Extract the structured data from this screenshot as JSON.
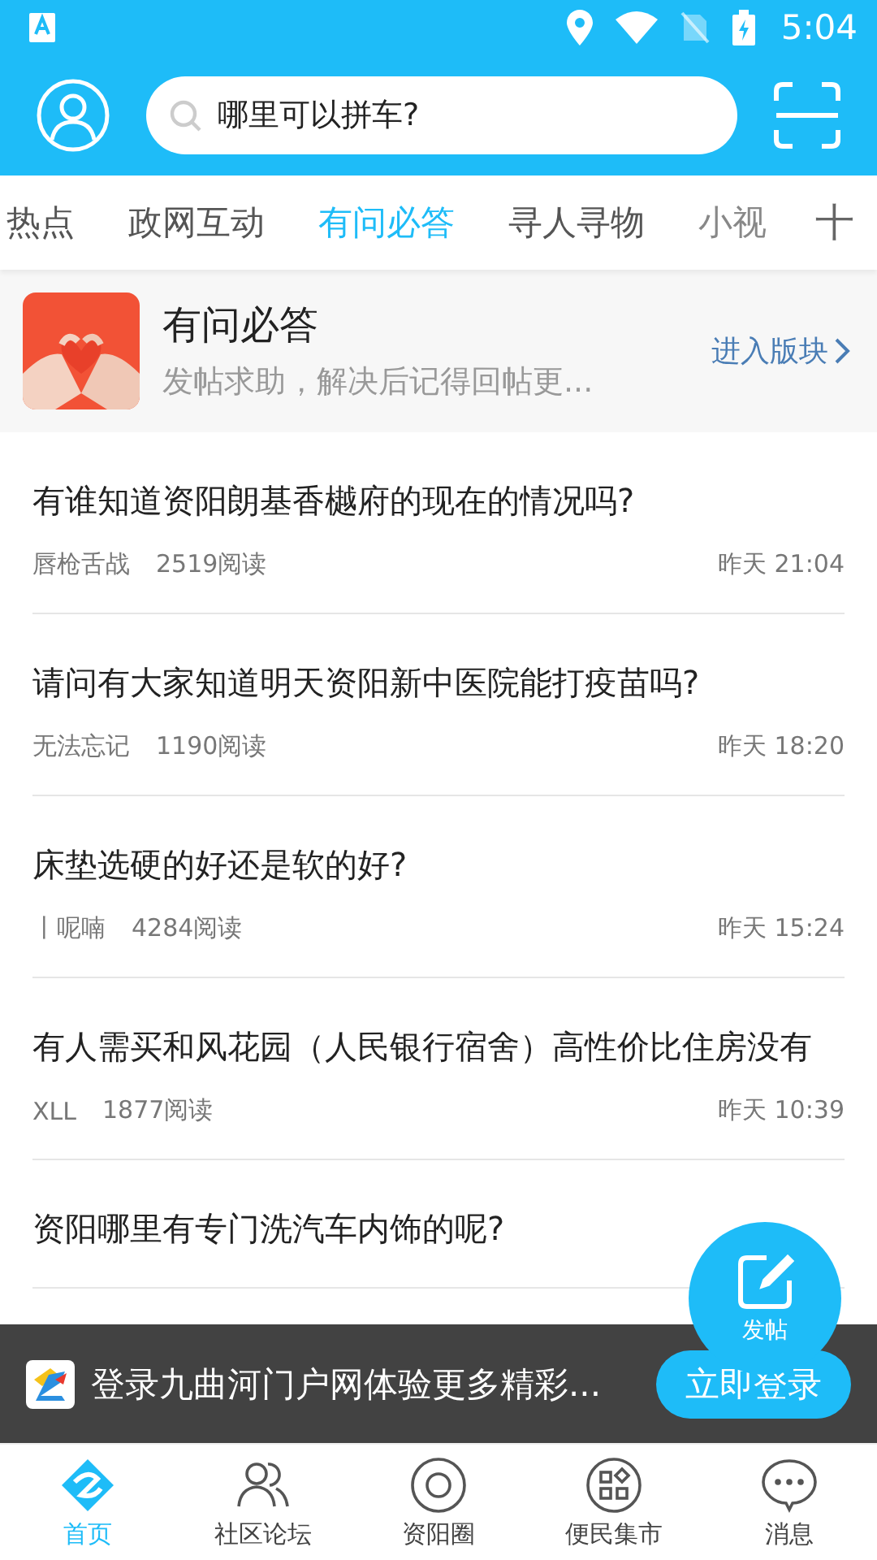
{
  "status_bar": {
    "time": "5:04"
  },
  "search": {
    "placeholder": "哪里可以拼车?"
  },
  "tabs": [
    {
      "label": "热点",
      "selected": false
    },
    {
      "label": "政网互动",
      "selected": false
    },
    {
      "label": "有问必答",
      "selected": true
    },
    {
      "label": "寻人寻物",
      "selected": false
    },
    {
      "label": "小视",
      "selected": false
    }
  ],
  "tabs_add": "十",
  "board": {
    "title": "有问必答",
    "description": "发帖求助，解决后记得回帖更...",
    "enter": "进入版块"
  },
  "posts": [
    {
      "title": "有谁知道资阳朗基香樾府的现在的情况吗?",
      "author": "唇枪舌战",
      "reads": "2519阅读",
      "time": "昨天 21:04"
    },
    {
      "title": "请问有大家知道明天资阳新中医院能打疫苗吗?",
      "author": "无法忘记",
      "reads": "1190阅读",
      "time": "昨天 18:20"
    },
    {
      "title": "床垫选硬的好还是软的好?",
      "author": "丨呢喃",
      "reads": "4284阅读",
      "time": "昨天 15:24"
    },
    {
      "title": "有人需买和风花园（人民银行宿舍）高性价比住房没有",
      "author": "XLL",
      "reads": "1877阅读",
      "time": "昨天 10:39"
    },
    {
      "title": "资阳哪里有专门洗汽车内饰的呢?"
    }
  ],
  "fab": {
    "label": "发帖"
  },
  "login_banner": {
    "text": "登录九曲河门户网体验更多精彩...",
    "button": "立即登录"
  },
  "nav": [
    {
      "label": "首页",
      "kind": "home",
      "selected": true
    },
    {
      "label": "社区论坛",
      "kind": "users",
      "selected": false
    },
    {
      "label": "资阳圈",
      "kind": "circle",
      "selected": false
    },
    {
      "label": "便民集市",
      "kind": "grid",
      "selected": false
    },
    {
      "label": "消息",
      "kind": "chat",
      "selected": false
    }
  ]
}
